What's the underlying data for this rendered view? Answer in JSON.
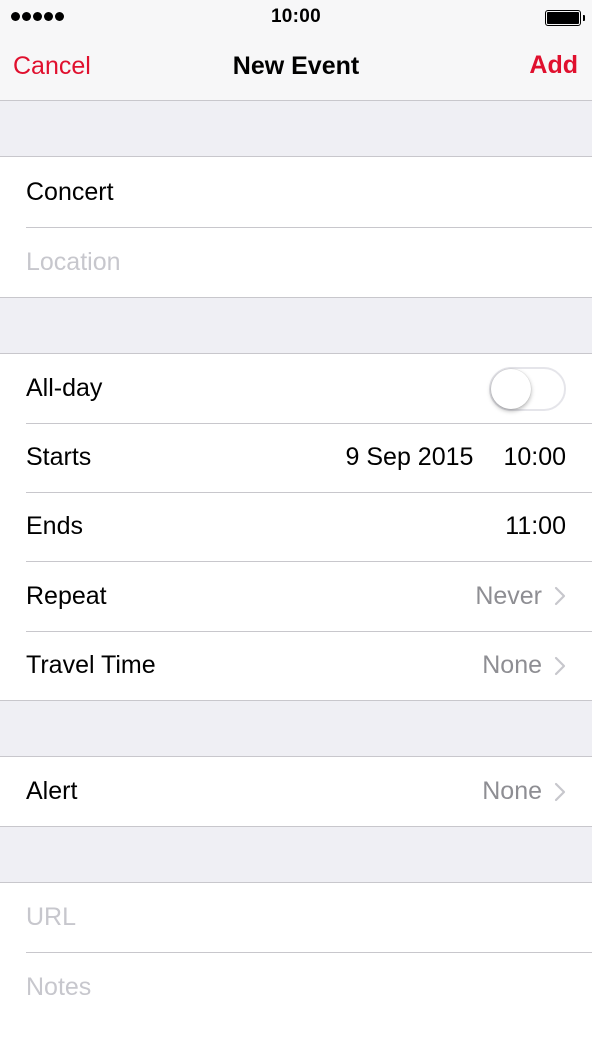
{
  "status_bar": {
    "time": "10:00",
    "signal_dots": 5,
    "battery_level": 1.0
  },
  "nav": {
    "cancel_label": "Cancel",
    "title": "New Event",
    "add_label": "Add",
    "accent_color": "#e0102e"
  },
  "event": {
    "title_value": "Concert",
    "location_placeholder": "Location"
  },
  "schedule": {
    "all_day_label": "All-day",
    "all_day_on": false,
    "starts_label": "Starts",
    "starts_date": "9 Sep 2015",
    "starts_time": "10:00",
    "ends_label": "Ends",
    "ends_time": "11:00",
    "repeat_label": "Repeat",
    "repeat_value": "Never",
    "travel_label": "Travel Time",
    "travel_value": "None"
  },
  "alert": {
    "label": "Alert",
    "value": "None"
  },
  "extra": {
    "url_placeholder": "URL",
    "notes_placeholder": "Notes"
  },
  "icons": {
    "disclosure": "chevron-right-icon",
    "battery": "battery-icon",
    "signal": "signal-dots-icon"
  }
}
